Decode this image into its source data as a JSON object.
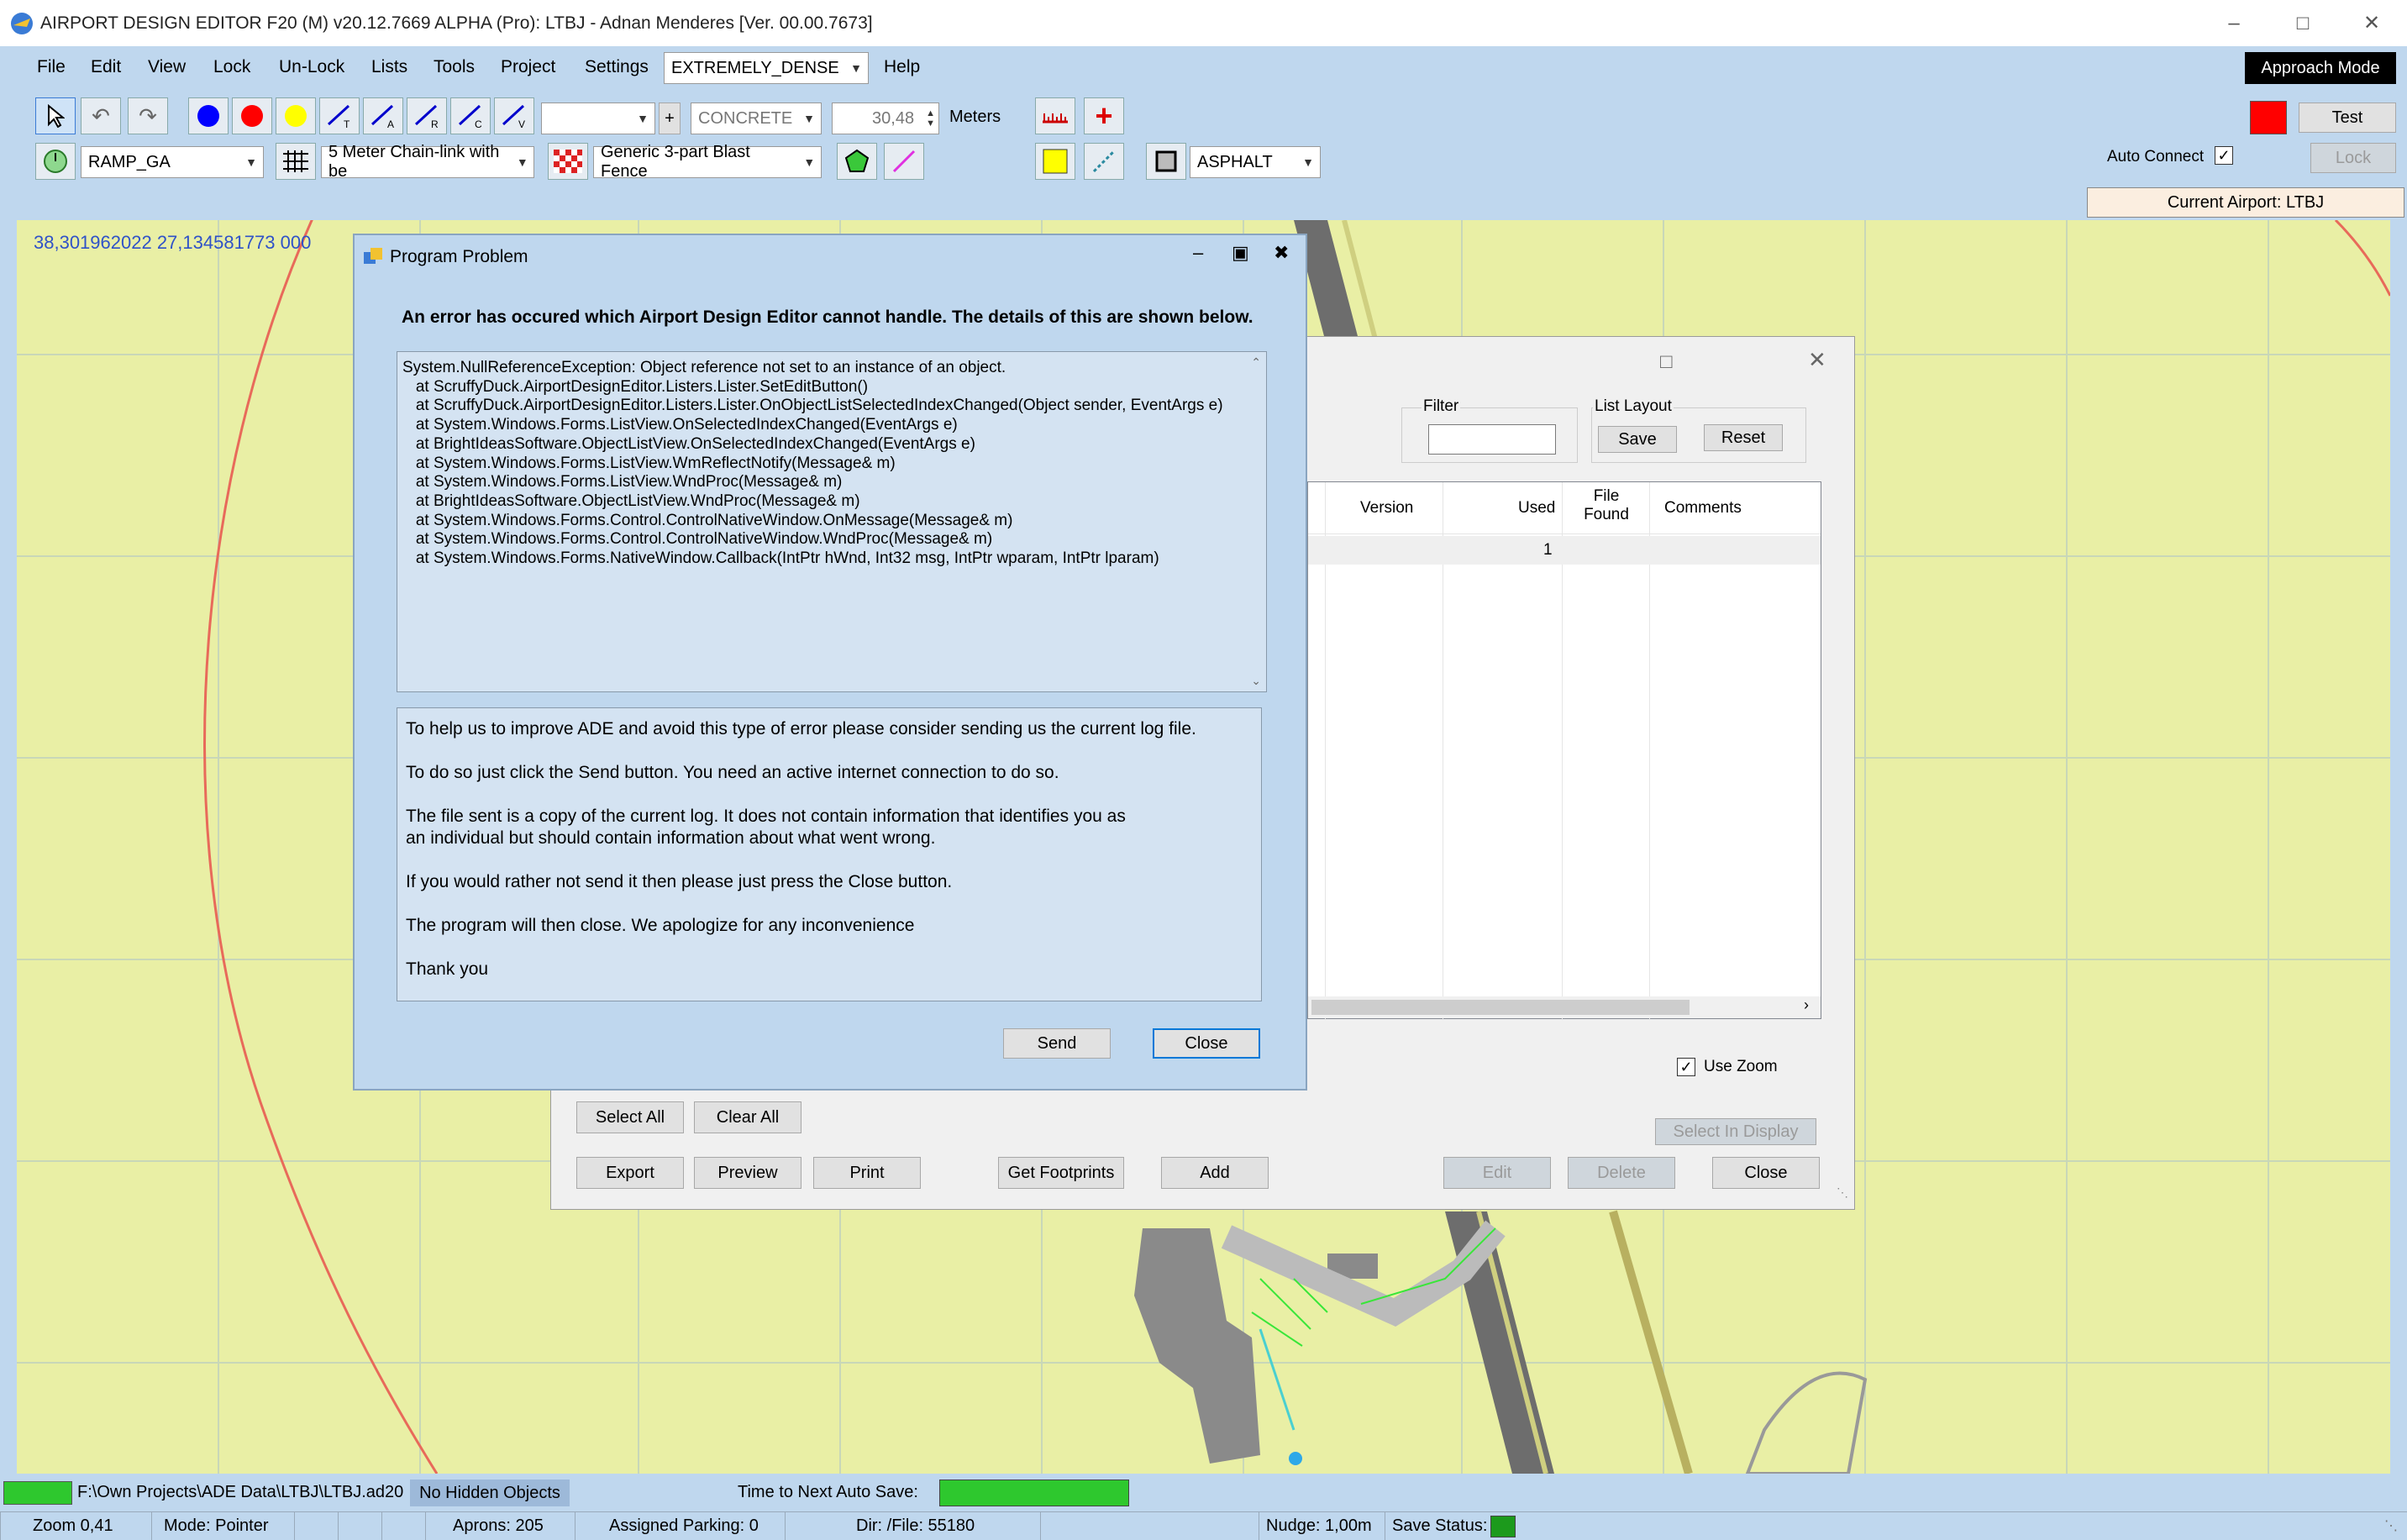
{
  "window": {
    "title": "AIRPORT DESIGN EDITOR F20 (M)  v20.12.7669 ALPHA (Pro): LTBJ - Adnan Menderes [Ver. 00.00.7673]"
  },
  "menu": [
    "File",
    "Edit",
    "View",
    "Lock",
    "Un-Lock",
    "Lists",
    "Tools",
    "Project",
    "Settings",
    "Help"
  ],
  "toolbar": {
    "density": "EXTREMELY_DENSE",
    "surface1": "CONCRETE",
    "width_value": "30,48",
    "width_unit": "Meters",
    "plus": "+",
    "ramp": "RAMP_GA",
    "fence": "5 Meter Chain-link with be",
    "blast_fence": "Generic 3-part Blast Fence",
    "surface2": "ASPHALT",
    "approach_mode": "Approach Mode",
    "test": "Test",
    "auto_connect": "Auto Connect",
    "lock": "Lock",
    "current_airport": "Current Airport: LTBJ",
    "colors": {
      "blue": "#0000ff",
      "red": "#ff0000",
      "yellow": "#ffff00"
    }
  },
  "map": {
    "coords": "38,301962022   27,134581773 000"
  },
  "lister": {
    "filter_label": "Filter",
    "layout_label": "List Layout",
    "save": "Save",
    "reset": "Reset",
    "columns": [
      "Version",
      "Used",
      "File Found",
      "Comments"
    ],
    "row_used": "1",
    "use_zoom": "Use Zoom",
    "select_in_display": "Select In Display",
    "buttons_row1": [
      "Select All",
      "Clear All"
    ],
    "buttons_row2": [
      "Export",
      "Preview",
      "Print",
      "Get Footprints",
      "Add",
      "Edit",
      "Delete",
      "Close"
    ]
  },
  "dialog": {
    "title": "Program Problem",
    "heading": "An error has occured which Airport Design Editor cannot handle.  The details of this are shown below.",
    "trace": [
      "System.NullReferenceException: Object reference not set to an instance of an object.",
      "   at ScruffyDuck.AirportDesignEditor.Listers.Lister.SetEditButton()",
      "   at ScruffyDuck.AirportDesignEditor.Listers.Lister.OnObjectListSelectedIndexChanged(Object sender, EventArgs e)",
      "   at System.Windows.Forms.ListView.OnSelectedIndexChanged(EventArgs e)",
      "   at BrightIdeasSoftware.ObjectListView.OnSelectedIndexChanged(EventArgs e)",
      "   at System.Windows.Forms.ListView.WmReflectNotify(Message& m)",
      "   at System.Windows.Forms.ListView.WndProc(Message& m)",
      "   at BrightIdeasSoftware.ObjectListView.WndProc(Message& m)",
      "   at System.Windows.Forms.Control.ControlNativeWindow.OnMessage(Message& m)",
      "   at System.Windows.Forms.Control.ControlNativeWindow.WndProc(Message& m)",
      "   at System.Windows.Forms.NativeWindow.Callback(IntPtr hWnd, Int32 msg, IntPtr wparam, IntPtr lparam)"
    ],
    "help": [
      "To help us to improve ADE and avoid this type of error please consider sending us the current log file.",
      "To do so just click the Send button.  You need an active internet connection to do so.",
      "The file sent is a copy of the current log.  It does not contain information that identifies you as an individual but should contain information about what went wrong.",
      "If you would rather not send it then please just press the Close button.",
      "The program will then close.  We apologize for any inconvenience",
      "Thank you"
    ],
    "send": "Send",
    "close": "Close"
  },
  "status": {
    "file": "F:\\Own Projects\\ADE Data\\LTBJ\\LTBJ.ad20",
    "hidden": "No Hidden Objects",
    "autosave": "Time to Next Auto Save:",
    "zoom": "Zoom 0,41",
    "mode": "Mode: Pointer",
    "aprons": "Aprons: 205",
    "parking": "Assigned Parking: 0",
    "dir": "Dir: /File: 55180",
    "nudge": "Nudge: 1,00m",
    "save_status": "Save Status:",
    "colors": {
      "ok": "#2ec82e"
    }
  }
}
